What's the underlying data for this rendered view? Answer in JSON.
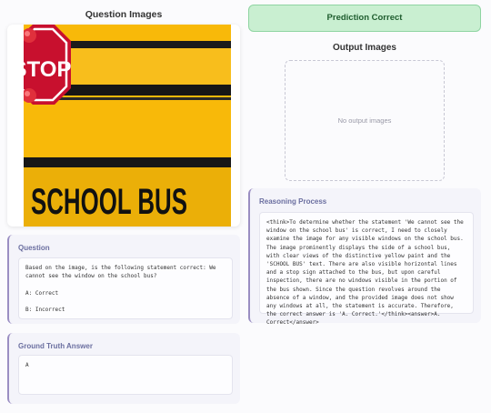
{
  "left": {
    "question_images_title": "Question Images",
    "image_alt": "school bus",
    "question": {
      "title": "Question",
      "text": "Based on the image, is the following statement correct: We cannot see the window on the school bus?\n\nA: Correct\n\nB: Incorrect"
    },
    "ground_truth": {
      "title": "Ground Truth Answer",
      "text": "A"
    }
  },
  "right": {
    "prediction_label": "Prediction Correct",
    "output_images_title": "Output Images",
    "no_output_text": "No output images",
    "reasoning": {
      "title": "Reasoning Process",
      "text": "<think>To determine whether the statement 'We cannot see the window on the school bus' is correct, I need to closely examine the image for any visible windows on the school bus. The image prominently displays the side of a school bus, with clear views of the distinctive yellow paint and the 'SCHOOL BUS' text. There are also visible horizontal lines and a stop sign attached to the bus, but upon careful inspection, there are no windows visible in the portion of the bus shown. Since the question revolves around the absence of a window, and the provided image does not show any windows at all, the statement is accurate. Therefore, the correct answer is 'A. Correct.'</think><answer>A. Correct</answer>"
    }
  },
  "image_content": {
    "sign_text": "STOP",
    "bus_text": "SCHOOL BUS"
  },
  "colors": {
    "bus_yellow": "#f5b400",
    "stop_red": "#c8102e",
    "success_bg": "#c9efd1",
    "accent_border": "#9a8ec2"
  }
}
